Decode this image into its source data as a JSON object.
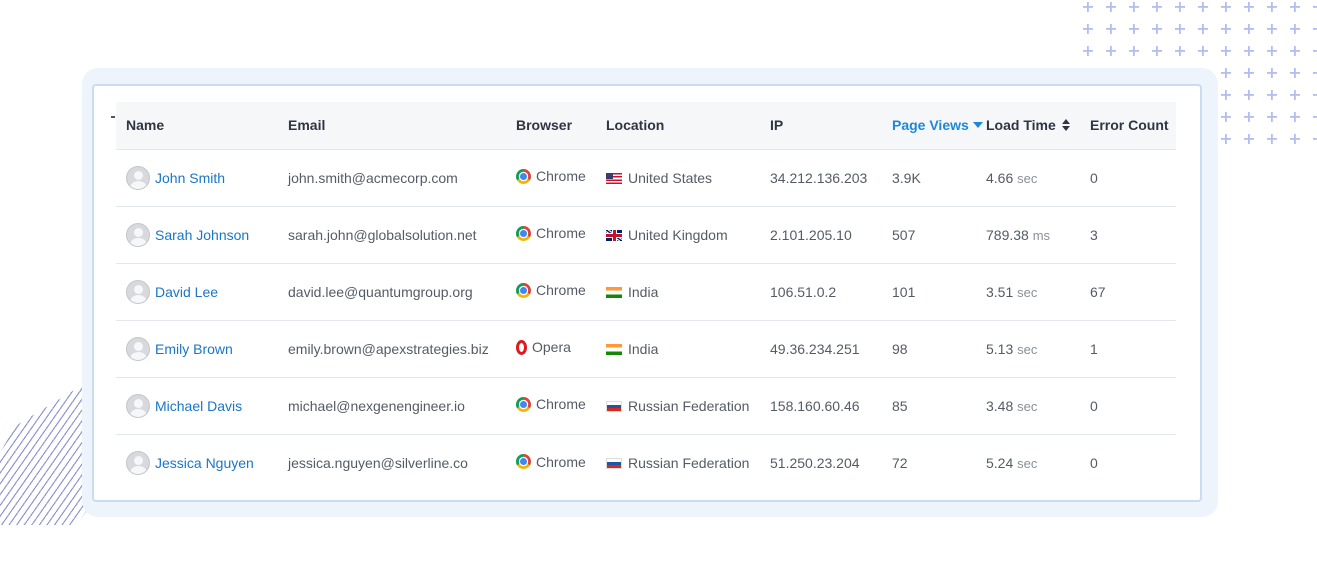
{
  "table": {
    "columns": [
      {
        "key": "name",
        "label": "Name"
      },
      {
        "key": "email",
        "label": "Email"
      },
      {
        "key": "browser",
        "label": "Browser"
      },
      {
        "key": "location",
        "label": "Location"
      },
      {
        "key": "ip",
        "label": "IP"
      },
      {
        "key": "page_views",
        "label": "Page Views",
        "sort": "descending"
      },
      {
        "key": "load_time",
        "label": "Load Time",
        "sort": "unsorted"
      },
      {
        "key": "error_count",
        "label": "Error Count"
      }
    ],
    "rows": [
      {
        "name": "John Smith",
        "email": "john.smith@acmecorp.com",
        "browser": "Chrome",
        "browser_icon": "chrome-icon",
        "location": "United States",
        "flag": "us-flag-icon",
        "ip": "34.212.136.203",
        "page_views": "3.9K",
        "load_value": "4.66",
        "load_unit": "sec",
        "error_count": "0"
      },
      {
        "name": "Sarah Johnson",
        "email": "sarah.john@globalsolution.net",
        "browser": "Chrome",
        "browser_icon": "chrome-icon",
        "location": "United Kingdom",
        "flag": "uk-flag-icon",
        "ip": "2.101.205.10",
        "page_views": "507",
        "load_value": "789.38",
        "load_unit": "ms",
        "error_count": "3"
      },
      {
        "name": "David Lee",
        "email": "david.lee@quantumgroup.org",
        "browser": "Chrome",
        "browser_icon": "chrome-icon",
        "location": "India",
        "flag": "india-flag-icon",
        "ip": "106.51.0.2",
        "page_views": "101",
        "load_value": "3.51",
        "load_unit": "sec",
        "error_count": "67"
      },
      {
        "name": "Emily Brown",
        "email": "emily.brown@apexstrategies.biz",
        "browser": "Opera",
        "browser_icon": "opera-icon",
        "location": "India",
        "flag": "india-flag-icon",
        "ip": "49.36.234.251",
        "page_views": "98",
        "load_value": "5.13",
        "load_unit": "sec",
        "error_count": "1"
      },
      {
        "name": "Michael Davis",
        "email": "michael@nexgenengineer.io",
        "browser": "Chrome",
        "browser_icon": "chrome-icon",
        "location": "Russian Federation",
        "flag": "russia-flag-icon",
        "ip": "158.160.60.46",
        "page_views": "85",
        "load_value": "3.48",
        "load_unit": "sec",
        "error_count": "0"
      },
      {
        "name": "Jessica Nguyen",
        "email": "jessica.nguyen@silverline.co",
        "browser": "Chrome",
        "browser_icon": "chrome-icon",
        "location": "Russian Federation",
        "flag": "russia-flag-icon",
        "ip": "51.250.23.204",
        "page_views": "72",
        "load_value": "5.24",
        "load_unit": "sec",
        "error_count": "0"
      }
    ]
  },
  "colors": {
    "link": "#1976c8",
    "sorted_header": "#1e88d8",
    "frame": "#eef4fc",
    "card_border": "#c9dcf2"
  }
}
